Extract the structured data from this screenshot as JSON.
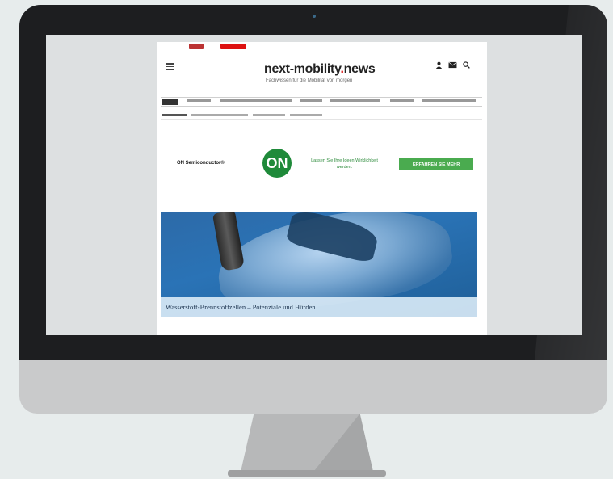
{
  "site": {
    "brand_name": "next-mobility",
    "brand_dot": ".",
    "brand_suffix": "news",
    "tagline": "Fachwissen für die Mobilität von morgen"
  },
  "ad": {
    "company": "ON Semiconductor®",
    "logo_text": "ON",
    "claim": "Lassen Sie Ihre Ideen Wirklichkeit werden.",
    "cta": "ERFAHREN SIE MEHR"
  },
  "hero": {
    "caption": "Wasserstoff-Brennstoffzellen – Potenziale und Hürden"
  },
  "icons": {
    "menu": "hamburger-menu-icon",
    "user": "user-icon",
    "mail": "mail-icon",
    "search": "search-icon"
  },
  "colors": {
    "brand_red": "#d11111",
    "ad_green": "#4aab4f",
    "hero_blue": "#2a73b6"
  }
}
